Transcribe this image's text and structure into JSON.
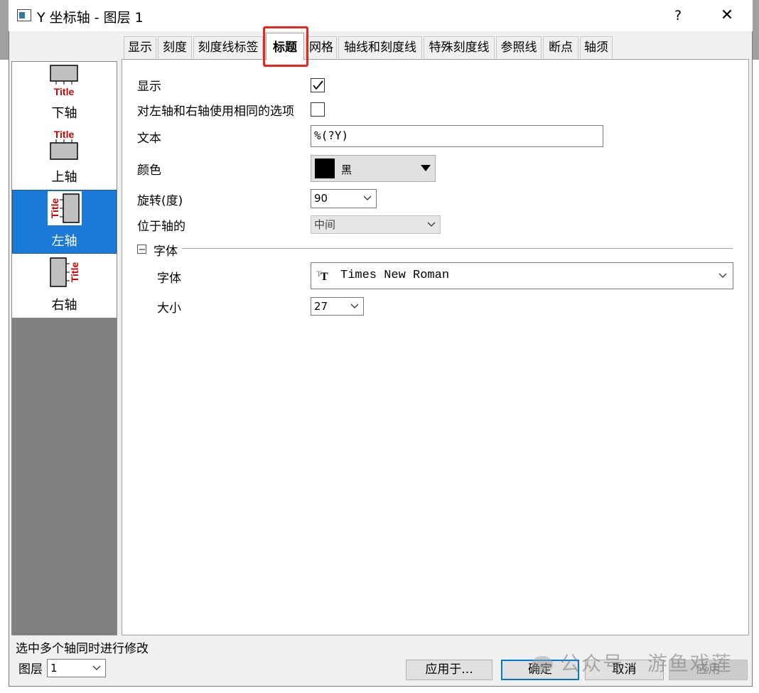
{
  "window": {
    "title": "Y 坐标轴 - 图层 1",
    "help": "?",
    "close": "✕"
  },
  "tabs": [
    {
      "label": "显示"
    },
    {
      "label": "刻度"
    },
    {
      "label": "刻度线标签"
    },
    {
      "label": "标题"
    },
    {
      "label": "网格"
    },
    {
      "label": "轴线和刻度线"
    },
    {
      "label": "特殊刻度线"
    },
    {
      "label": "参照线"
    },
    {
      "label": "断点"
    },
    {
      "label": "轴须"
    }
  ],
  "active_tab": "标题",
  "axes": [
    {
      "label": "下轴",
      "icon_text": "Title",
      "icon": "bottom-axis-title-icon"
    },
    {
      "label": "上轴",
      "icon_text": "Title",
      "icon": "top-axis-title-icon"
    },
    {
      "label": "左轴",
      "icon_text": "Title",
      "icon": "left-axis-title-icon"
    },
    {
      "label": "右轴",
      "icon_text": "Title",
      "icon": "right-axis-title-icon"
    }
  ],
  "selected_axis": "左轴",
  "form": {
    "show_label": "显示",
    "show_checked": true,
    "same_label": "对左轴和右轴使用相同的选项",
    "same_checked": false,
    "text_label": "文本",
    "text_value": "%(?Y)",
    "color_label": "颜色",
    "color_value": "黑",
    "color_hex": "#000000",
    "rotation_label": "旋转(度)",
    "rotation_value": "90",
    "position_label": "位于轴的",
    "position_value": "中间",
    "font_section": "字体",
    "font_label": "字体",
    "font_value": "Times New Roman",
    "size_label": "大小",
    "size_value": "27"
  },
  "footer": {
    "hint": "选中多个轴同时进行修改",
    "layer_label": "图层",
    "layer_value": "1",
    "apply_to": "应用于...",
    "ok": "确定",
    "cancel": "取消",
    "apply": "应用"
  },
  "watermark": "公众号 · 游鱼戏莲",
  "colors": {
    "selection": "#1a7ad8",
    "highlight_box": "#e8261d",
    "title_red": "#d40000"
  }
}
